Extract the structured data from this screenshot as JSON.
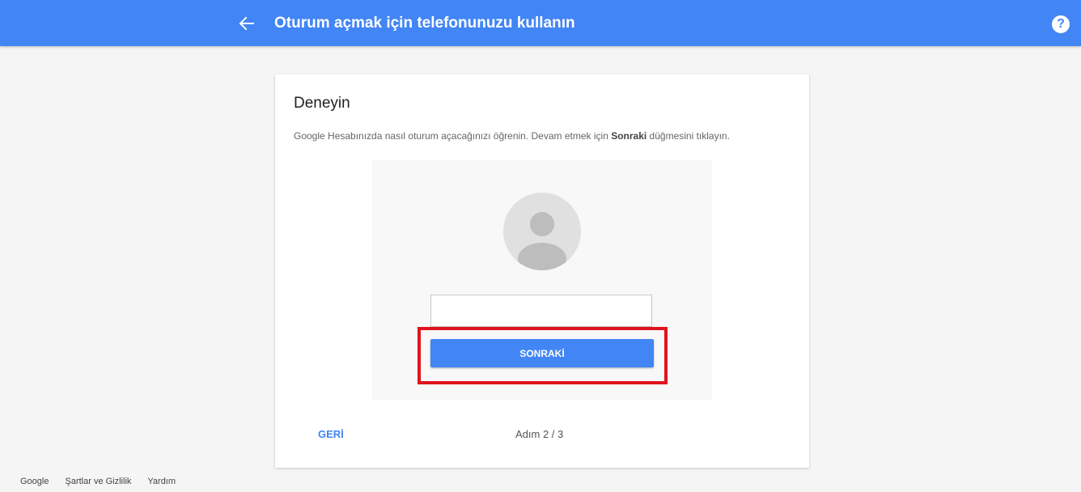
{
  "appbar": {
    "title": "Oturum açmak için telefonunuzu kullanın",
    "back_icon": "arrow-back-icon",
    "help_label": "?",
    "color": "#4285f4"
  },
  "card": {
    "title": "Deneyin",
    "description_before": "Google Hesabınızda nasıl oturum açacağınızı öğrenin. Devam etmek için ",
    "description_bold": "Sonraki",
    "description_after": " düğmesini tıklayın.",
    "demo": {
      "avatar_icon": "avatar-placeholder-icon",
      "input_value": "",
      "next_button_label": "SONRAKİ"
    },
    "back_label": "GERİ",
    "step_label": "Adım 2 / 3"
  },
  "highlight": {
    "color": "#e0141c"
  },
  "footer": {
    "links": [
      "Google",
      "Şartlar ve Gizlilik",
      "Yardım"
    ]
  }
}
